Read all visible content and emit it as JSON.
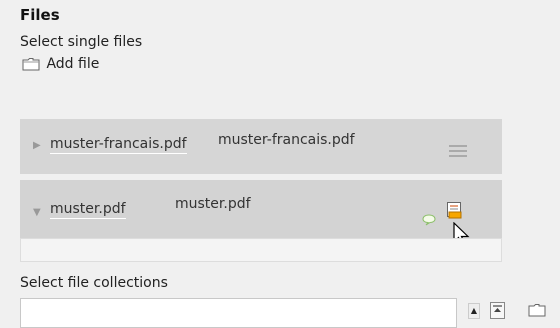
{
  "section": {
    "title": "Files",
    "single_label": "Select single files",
    "add_file_label": "Add file"
  },
  "files": [
    {
      "link": "muster-francais.pdf",
      "name": "muster-francais.pdf"
    },
    {
      "link": "muster.pdf",
      "name": "muster.pdf"
    }
  ],
  "collections": {
    "label": "Select file collections",
    "value": ""
  }
}
